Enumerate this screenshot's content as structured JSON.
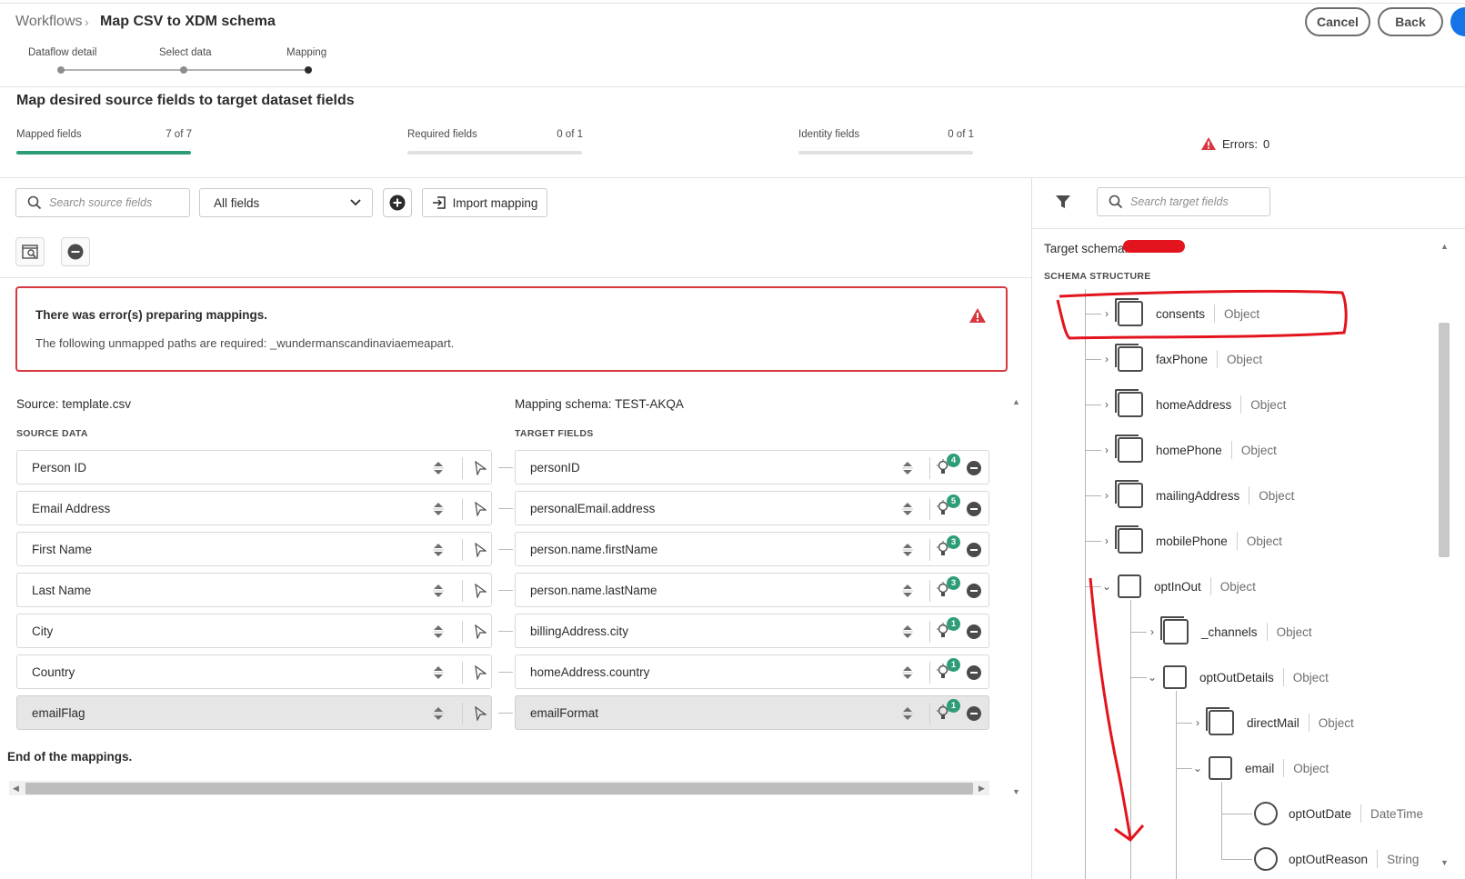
{
  "header": {
    "breadcrumb_root": "Workflows",
    "breadcrumb_sep": "›",
    "breadcrumb_current": "Map CSV to XDM schema",
    "cancel_label": "Cancel",
    "back_label": "Back"
  },
  "steps": [
    {
      "label": "Dataflow detail"
    },
    {
      "label": "Select data"
    },
    {
      "label": "Mapping"
    }
  ],
  "summary": {
    "title": "Map desired source fields to target dataset fields",
    "mapped": {
      "label": "Mapped fields",
      "value": "7 of 7",
      "fraction": 1.0
    },
    "required": {
      "label": "Required fields",
      "value": "0 of 1",
      "fraction": 0.0
    },
    "identity": {
      "label": "Identity fields",
      "value": "0 of 1",
      "fraction": 0.0
    },
    "errors_label": "Errors:",
    "errors_count": "0"
  },
  "toolbar": {
    "source_search_placeholder": "Search source fields",
    "filter_value": "All fields",
    "import_label": "Import mapping"
  },
  "error_card": {
    "title": "There was error(s) preparing mappings.",
    "message": "The following unmapped paths are required: _wundermanscandinaviaemeapart."
  },
  "mapping": {
    "source_title": "Source: template.csv",
    "schema_title": "Mapping schema: TEST-AKQA",
    "source_header": "SOURCE DATA",
    "target_header": "TARGET FIELDS",
    "rows": [
      {
        "source": "Person ID",
        "target": "personID",
        "suggestions": "4"
      },
      {
        "source": "Email Address",
        "target": "personalEmail.address",
        "suggestions": "5"
      },
      {
        "source": "First Name",
        "target": "person.name.firstName",
        "suggestions": "3"
      },
      {
        "source": "Last Name",
        "target": "person.name.lastName",
        "suggestions": "3"
      },
      {
        "source": "City",
        "target": "billingAddress.city",
        "suggestions": "1"
      },
      {
        "source": "Country",
        "target": "homeAddress.country",
        "suggestions": "1"
      },
      {
        "source": "emailFlag",
        "target": "emailFormat",
        "suggestions": "1"
      }
    ],
    "end_label": "End of the mappings."
  },
  "target_panel": {
    "search_placeholder": "Search target fields",
    "schema_label": "Target schema:",
    "structure_label": "SCHEMA STRUCTURE",
    "nodes": [
      {
        "name": "consents",
        "type": "Object",
        "expanded": false
      },
      {
        "name": "faxPhone",
        "type": "Object",
        "expanded": false
      },
      {
        "name": "homeAddress",
        "type": "Object",
        "expanded": false
      },
      {
        "name": "homePhone",
        "type": "Object",
        "expanded": false
      },
      {
        "name": "mailingAddress",
        "type": "Object",
        "expanded": false
      },
      {
        "name": "mobilePhone",
        "type": "Object",
        "expanded": false
      },
      {
        "name": "optInOut",
        "type": "Object",
        "expanded": true
      },
      {
        "name": "_channels",
        "type": "Object",
        "expanded": false
      },
      {
        "name": "optOutDetails",
        "type": "Object",
        "expanded": true
      },
      {
        "name": "directMail",
        "type": "Object",
        "expanded": false
      },
      {
        "name": "email",
        "type": "Object",
        "expanded": true
      },
      {
        "name": "optOutDate",
        "type": "DateTime"
      },
      {
        "name": "optOutReason",
        "type": "String"
      }
    ]
  },
  "colors": {
    "accent_green": "#2d9d78",
    "error_red": "#d7373f",
    "primary_blue": "#1473e6",
    "annotation_red": "#e3141e"
  }
}
